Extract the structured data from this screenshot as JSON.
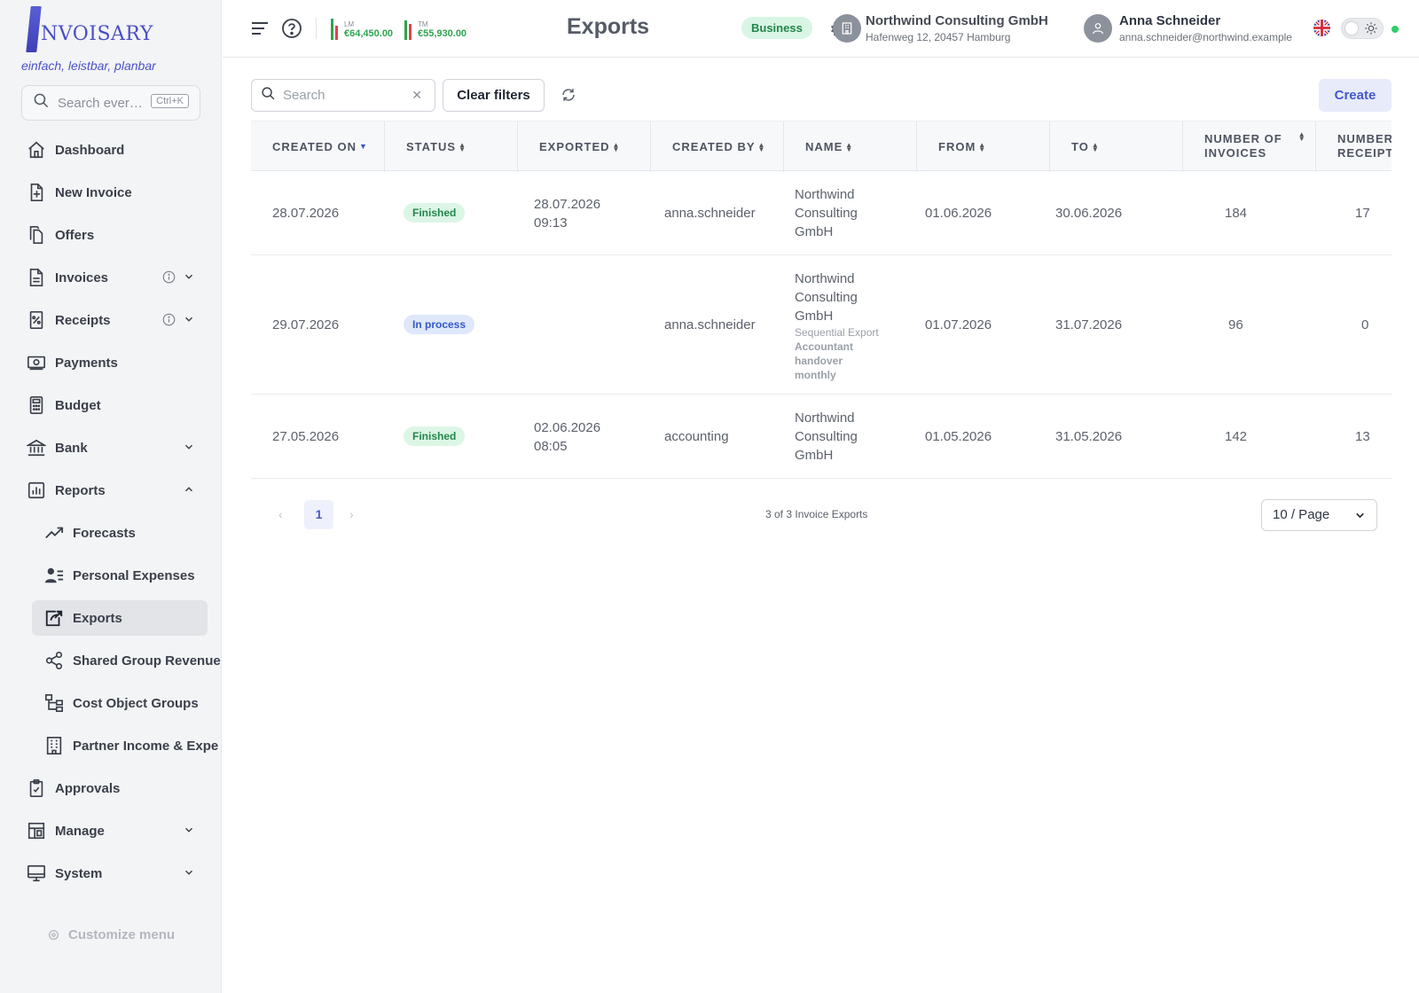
{
  "brand": {
    "logo_text": "NVOISARY",
    "tagline": "einfach, leistbar, planbar"
  },
  "sidebar": {
    "search_placeholder": "Search ever…",
    "shortcut": "Ctrl+K",
    "items": [
      {
        "label": "Dashboard"
      },
      {
        "label": "New Invoice"
      },
      {
        "label": "Offers"
      },
      {
        "label": "Invoices"
      },
      {
        "label": "Receipts"
      },
      {
        "label": "Payments"
      },
      {
        "label": "Budget"
      },
      {
        "label": "Bank"
      },
      {
        "label": "Reports"
      },
      {
        "label": "Forecasts"
      },
      {
        "label": "Personal Expenses"
      },
      {
        "label": "Exports"
      },
      {
        "label": "Shared Group Revenue"
      },
      {
        "label": "Cost Object Groups"
      },
      {
        "label": "Partner Income & Expe"
      },
      {
        "label": "Approvals"
      },
      {
        "label": "Manage"
      },
      {
        "label": "System"
      }
    ],
    "customize": "Customize menu"
  },
  "topbar": {
    "stat_lm_label": "LM",
    "stat_lm_value": "€64,450.00",
    "stat_tm_label": "TM",
    "stat_tm_value": "€55,930.00",
    "title": "Exports",
    "plan_badge": "Business",
    "company_name": "Northwind Consulting GmbH",
    "company_address": "Hafenweg 12, 20457 Hamburg",
    "user_name": "Anna Schneider",
    "user_email": "anna.schneider@northwind.example",
    "status_color": "#2fce6b"
  },
  "toolbar": {
    "search_placeholder": "Search",
    "clear_filters": "Clear filters",
    "create": "Create"
  },
  "table": {
    "columns": [
      "CREATED ON",
      "STATUS",
      "EXPORTED",
      "CREATED BY",
      "NAME",
      "FROM",
      "TO",
      "NUMBER OF INVOICES",
      "NUMBER OF RECEIPTS"
    ],
    "col_labels": {
      "number_of_invoices_1": "NUMBER OF",
      "number_of_invoices_2": "INVOICES",
      "number_of_receipts_1": "NUMBER",
      "number_of_receipts_2": "RECEIPTS"
    },
    "rows": [
      {
        "created_on": "28.07.2026",
        "status": "Finished",
        "exported_date": "28.07.2026",
        "exported_time": "09:13",
        "created_by": "anna.schneider",
        "name1": "Northwind",
        "name2": "Consulting",
        "name3": "GmbH",
        "from": "01.06.2026",
        "to": "30.06.2026",
        "invoices": "184",
        "receipts": "17"
      },
      {
        "created_on": "29.07.2026",
        "status": "In process",
        "exported_date": "",
        "exported_time": "",
        "created_by": "anna.schneider",
        "name1": "Northwind",
        "name2": "Consulting",
        "name3": "GmbH",
        "meta_sub": "Sequential Export",
        "meta_1": "Accountant",
        "meta_2": "handover",
        "meta_3": "monthly",
        "from": "01.07.2026",
        "to": "31.07.2026",
        "invoices": "96",
        "receipts": "0"
      },
      {
        "created_on": "27.05.2026",
        "status": "Finished",
        "exported_date": "02.06.2026",
        "exported_time": "08:05",
        "created_by": "accounting",
        "name1": "Northwind",
        "name2": "Consulting",
        "name3": "GmbH",
        "from": "01.05.2026",
        "to": "31.05.2026",
        "invoices": "142",
        "receipts": "13"
      }
    ]
  },
  "pagination": {
    "current_page": "1",
    "info": "3 of 3 Invoice Exports",
    "page_size": "10 / Page"
  }
}
